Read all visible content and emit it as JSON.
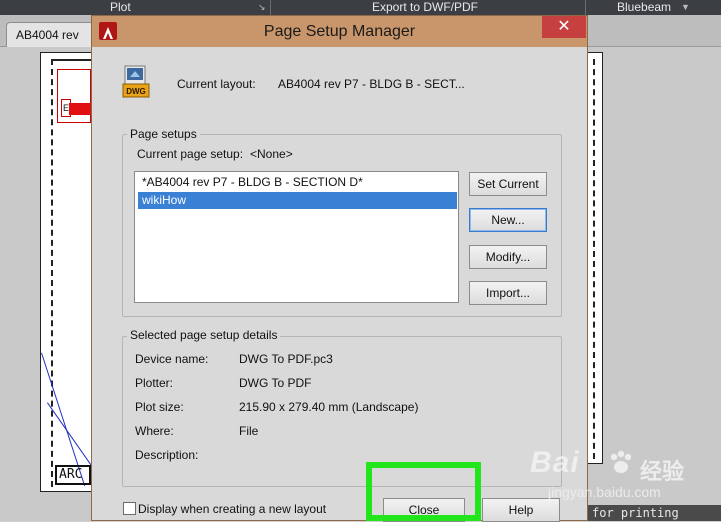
{
  "background": {
    "ribbon_tabs": [
      {
        "label": "Plot"
      },
      {
        "label": "Export to DWF/PDF"
      },
      {
        "label": "Bluebeam"
      }
    ],
    "document_tab": "AB4004 rev",
    "title_block_text": "ARC",
    "status_text": "for printing"
  },
  "dialog": {
    "title": "Page Setup Manager",
    "close_glyph": "✕",
    "current_layout_label": "Current layout:",
    "current_layout_value": "AB4004 rev P7 - BLDG B - SECT...",
    "dwg_icon_text": "DWG",
    "page_setups": {
      "group_title": "Page setups",
      "current_label": "Current page setup:",
      "current_value": "<None>",
      "items": [
        {
          "label": "*AB4004 rev P7 - BLDG B - SECTION D*",
          "selected": false
        },
        {
          "label": "wikiHow",
          "selected": true
        }
      ],
      "buttons": {
        "set_current": "Set Current",
        "new": "New...",
        "modify": "Modify...",
        "import": "Import..."
      }
    },
    "details": {
      "group_title": "Selected page setup details",
      "device_name_label": "Device name:",
      "device_name_value": "DWG To PDF.pc3",
      "plotter_label": "Plotter:",
      "plotter_value": "DWG To PDF",
      "plot_size_label": "Plot size:",
      "plot_size_value": "215.90 x 279.40 mm (Landscape)",
      "where_label": "Where:",
      "where_value": "File",
      "description_label": "Description:",
      "description_value": ""
    },
    "display_checkbox_label": "Display when creating a new layout",
    "display_checkbox_checked": false,
    "close_button": "Close",
    "help_button": "Help",
    "highlight_color": "#22e51c"
  },
  "watermark": {
    "brand": "Bai",
    "brand_cn": "经验",
    "url": "jingyan.baidu.com"
  }
}
